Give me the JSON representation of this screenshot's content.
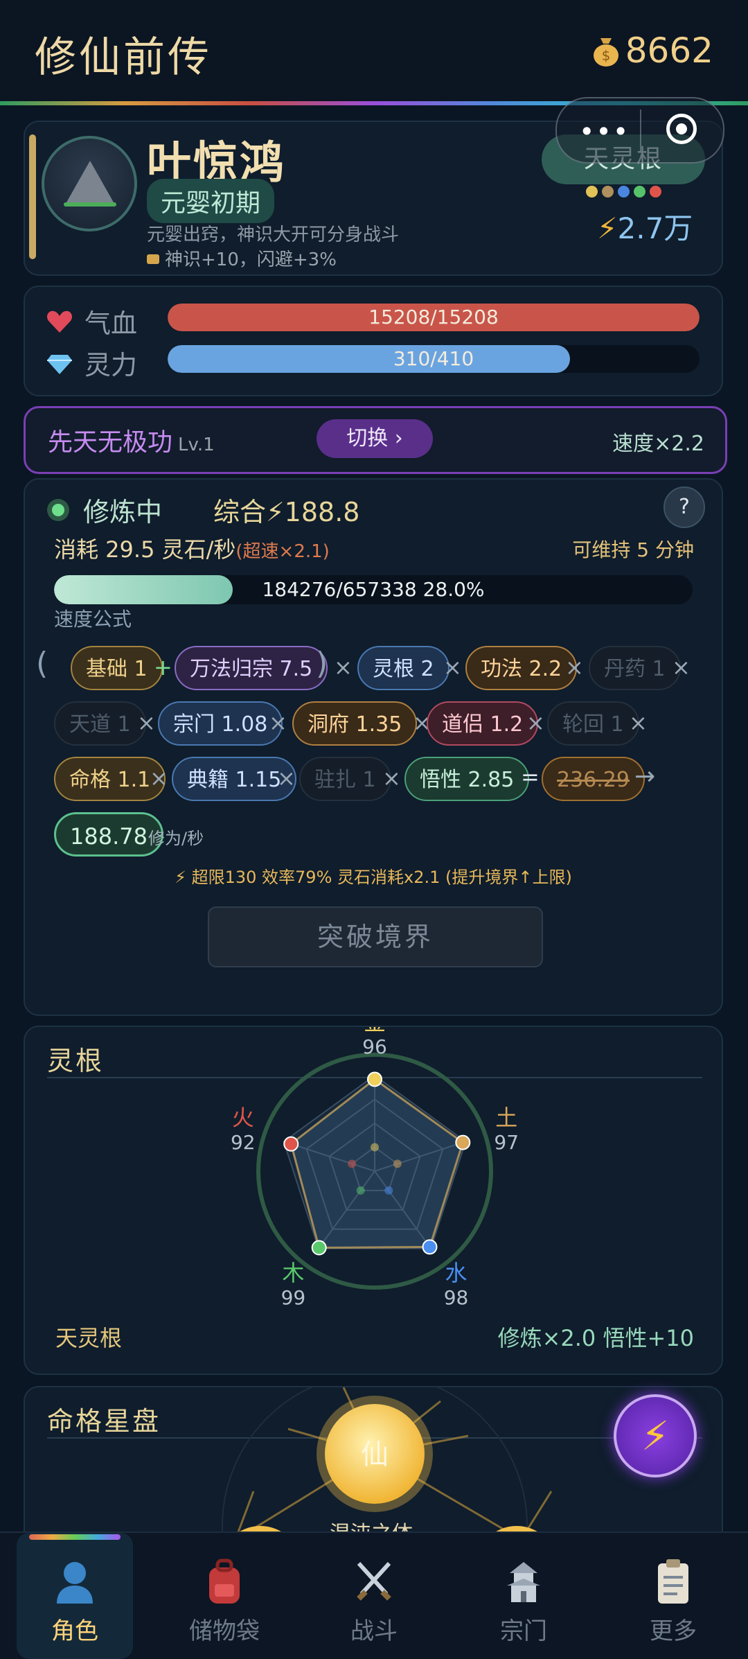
{
  "app": {
    "title": "修仙前传",
    "coins": "8662"
  },
  "profile": {
    "name": "叶惊鸿",
    "realm": "元婴初期",
    "description": "元婴出窍，神识大开可分身战斗",
    "bonus": "神识+10，闪避+3%",
    "root_badge": "天灵根",
    "power": "2.7万",
    "element_colors": [
      "#e0c257",
      "#b0905e",
      "#4a86e0",
      "#56c26a",
      "#e0554a"
    ]
  },
  "vitals": {
    "hp": {
      "label": "气血",
      "text": "15208/15208",
      "ratio": 1.0,
      "color": "#c9554a"
    },
    "mp": {
      "label": "灵力",
      "text": "310/410",
      "ratio": 0.756,
      "color": "#6aa4e0"
    }
  },
  "method": {
    "name": "先天无极功",
    "level": "Lv.1",
    "switch": "切换 ›",
    "speed": "速度×2.2"
  },
  "cultivation": {
    "status": "修炼中",
    "total": "综合⚡188.8",
    "consume": "消耗 29.5 灵石/秒",
    "consume_boost": "(超速×2.1)",
    "sustain": "可维持 5 分钟",
    "progress_text": "184276/657338  28.0%",
    "progress_ratio": 0.28,
    "formula_label": "速度公式",
    "chips": {
      "base": "基础 1",
      "wanfa": "万法归宗 7.5",
      "root": "灵根 2",
      "gongfa": "功法 2.2",
      "danyao": "丹药 1",
      "tiandao": "天道 1",
      "zongmen": "宗门 1.08",
      "dongfu": "洞府 1.35",
      "daolv": "道侣 1.2",
      "lunhui": "轮回 1",
      "mingge": "命格 1.1",
      "dianji": "典籍 1.15",
      "zhuzha": "驻扎 1",
      "wuxing": "悟性 2.85",
      "raw": "236.29",
      "result": "188.78"
    },
    "rate_unit": "修为/秒",
    "overlimit": "⚡ 超限130 效率79% 灵石消耗x2.1 (提升境界↑上限)",
    "breakthrough": "突破境界"
  },
  "roots": {
    "title": "灵根",
    "footer_left": "天灵根",
    "footer_right": "修炼×2.0  悟性+10",
    "elements": [
      {
        "name": "金",
        "value": 96,
        "color": "#f0cf5a"
      },
      {
        "name": "土",
        "value": 97,
        "color": "#d9a65a"
      },
      {
        "name": "水",
        "value": 98,
        "color": "#4a8ef0"
      },
      {
        "name": "木",
        "value": 99,
        "color": "#59c86a"
      },
      {
        "name": "火",
        "value": 92,
        "color": "#e0554a"
      }
    ]
  },
  "stars": {
    "title": "命格星盘",
    "center": "仙",
    "caption": "混沌之体"
  },
  "tabs": [
    {
      "label": "角色",
      "icon": "person-icon",
      "active": true
    },
    {
      "label": "储物袋",
      "icon": "backpack-icon",
      "active": false
    },
    {
      "label": "战斗",
      "icon": "crossed-swords-icon",
      "active": false
    },
    {
      "label": "宗门",
      "icon": "pagoda-icon",
      "active": false
    },
    {
      "label": "更多",
      "icon": "clipboard-icon",
      "active": false
    }
  ]
}
